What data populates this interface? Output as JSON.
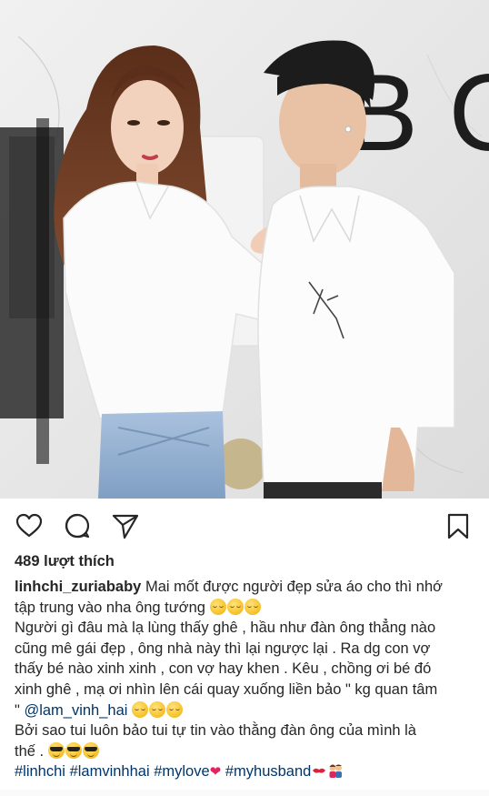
{
  "post": {
    "likes": "489 lượt thích",
    "caption_lines": [
      {
        "username": "linhchi_zuriababy",
        "text": " Mai mốt được người đẹp sửa áo cho thì nhớ"
      },
      {
        "text": "tập trung vào nha ông tướng "
      },
      {
        "text": "Người gì đâu mà lạ lùng thấy ghê , hầu như đàn ông thẳng nào"
      },
      {
        "text": "cũng mê gái đẹp , ông nhà này thì lại ngược lại . Ra dg con vợ"
      },
      {
        "text": "thấy bé nào xinh xinh , con vợ hay khen . Kêu , chồng ơi bé đó"
      },
      {
        "text": "xinh ghê , mạ ơi nhìn lên cái quay xuống liền bảo \" kg quan tâm"
      },
      {
        "prefix": "\" ",
        "mention": "@lam_vinh_hai",
        "text": " "
      },
      {
        "text": "Bởi sao tui luôn bảo tui tự tin vào thằng đàn ông của mình là"
      },
      {
        "text": "thế . "
      },
      {
        "hashtags": [
          "#linhchi",
          "#lamvinhhai",
          "#mylove",
          "#myhusband"
        ]
      }
    ]
  },
  "photo": {
    "wall_letters": "B C",
    "description_colors": {
      "wall": "#e8e8e8",
      "shirt": "#fafafa",
      "jeans": "#8fb0d4",
      "hair_woman": "#6b3a22",
      "hair_man": "#1c1c1c"
    }
  },
  "icons": {
    "like": "heart-icon",
    "comment": "comment-icon",
    "share": "send-icon",
    "save": "bookmark-icon"
  },
  "colors": {
    "text": "#262626",
    "link": "#003569",
    "icon": "#262626"
  }
}
